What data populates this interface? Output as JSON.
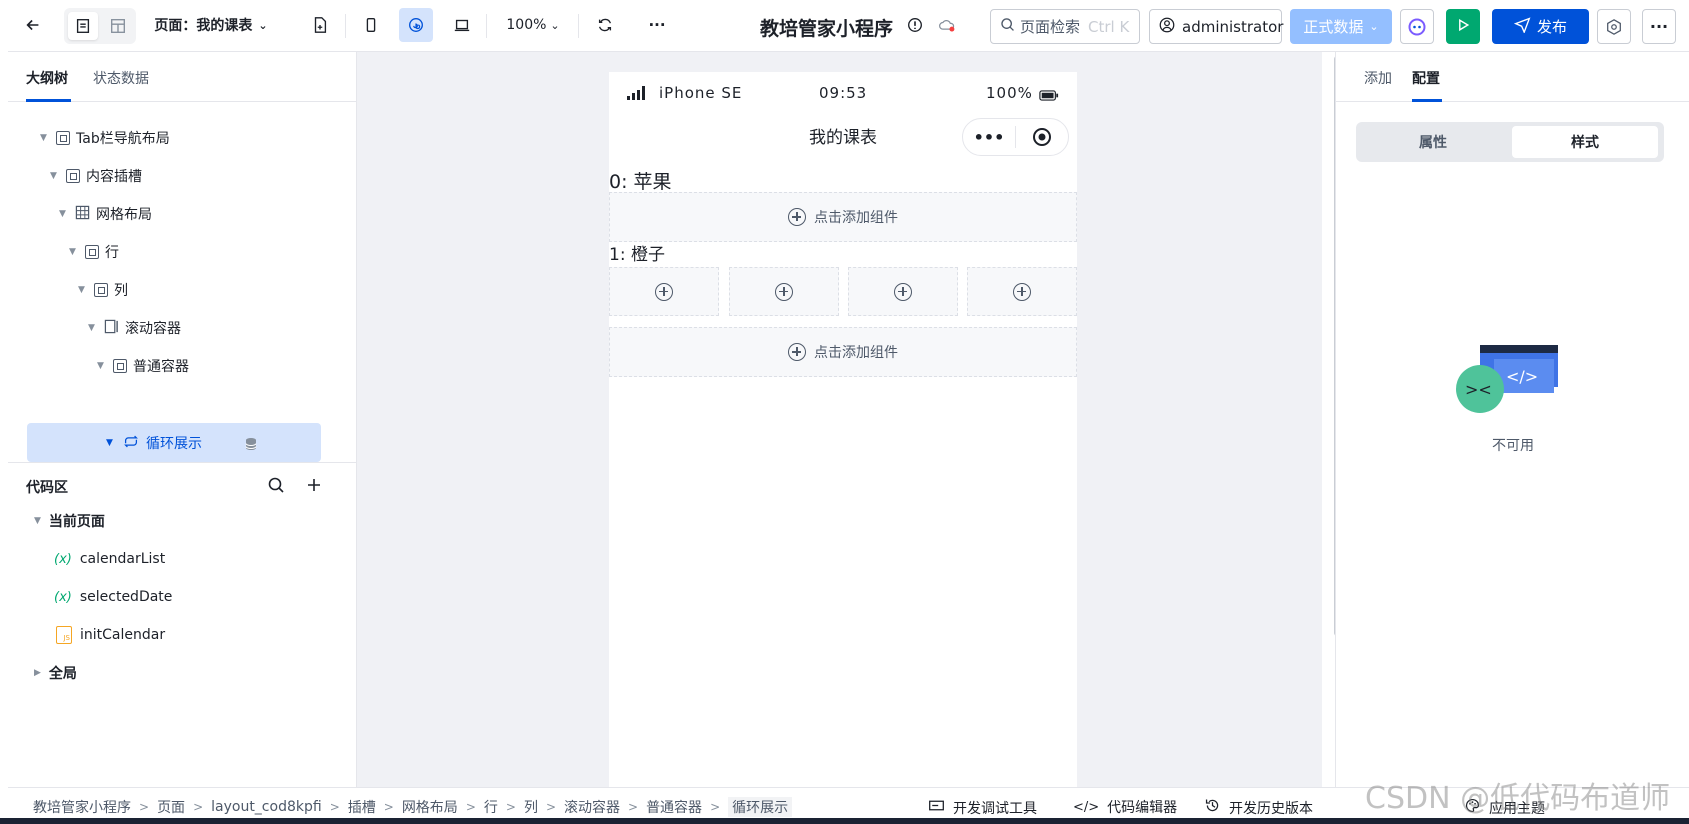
{
  "topbar": {
    "page_label": "页面：我的课表",
    "zoom": "100%",
    "app_title": "教培管家小程序",
    "search_placeholder": "页面检索",
    "search_shortcut": "Ctrl K",
    "user": "administrator",
    "env": "正式数据",
    "publish": "发布",
    "more": "···"
  },
  "left": {
    "tabs": [
      "大纲树",
      "状态数据"
    ],
    "tree": [
      {
        "label": "Tab栏导航布局"
      },
      {
        "label": "内容插槽"
      },
      {
        "label": "网格布局"
      },
      {
        "label": "行"
      },
      {
        "label": "列"
      },
      {
        "label": "滚动容器"
      },
      {
        "label": "普通容器"
      },
      {
        "label": "循环展示"
      }
    ],
    "code_title": "代码区",
    "code_groups": {
      "current": "当前页面",
      "global": "全局"
    },
    "code_items": [
      {
        "icon": "(x)",
        "label": "calendarList"
      },
      {
        "icon": "(x)",
        "label": "selectedDate"
      },
      {
        "icon": "JS",
        "label": "initCalendar"
      }
    ]
  },
  "phone": {
    "device": "iPhone SE",
    "time": "09:53",
    "battery": "100%",
    "title": "我的课表",
    "items": [
      "0: 苹果",
      "1: 橙子"
    ],
    "add_component": "点击添加组件"
  },
  "right": {
    "tabs": [
      "添加",
      "配置"
    ],
    "seg": [
      "属性",
      "样式"
    ],
    "empty_text": "不可用"
  },
  "footer": {
    "crumbs": [
      "教培管家小程序",
      "页面",
      "layout_cod8kpfi",
      "插槽",
      "网格布局",
      "行",
      "列",
      "滚动容器",
      "普通容器",
      "循环展示"
    ],
    "tools": [
      "开发调试工具",
      "代码编辑器",
      "开发历史版本",
      "应用主题"
    ]
  },
  "watermark": "CSDN @低代码布道师",
  "colors": {
    "primary": "#0052d9",
    "success": "#00a870",
    "selected_bg": "#d4e3fc",
    "env_btn": "#94bfff"
  }
}
